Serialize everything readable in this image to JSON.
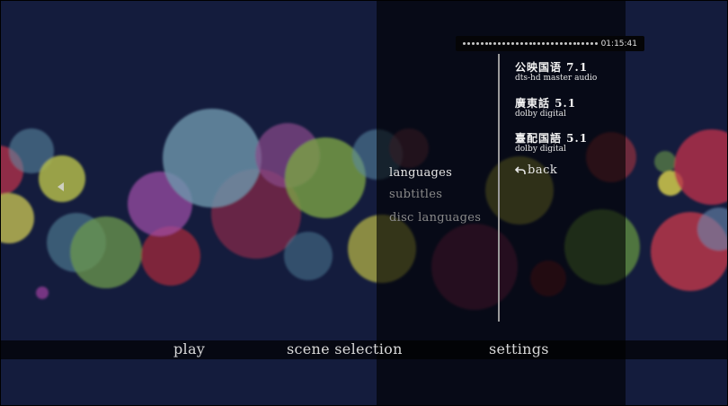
{
  "bottom_nav": {
    "items": [
      {
        "id": "play",
        "label": "play"
      },
      {
        "id": "scene_selection",
        "label": "scene selection"
      },
      {
        "id": "settings",
        "label": "settings"
      }
    ]
  },
  "settings_menu": {
    "items": [
      {
        "id": "languages",
        "label": "languages",
        "state": "active"
      },
      {
        "id": "subtitles",
        "label": "subtitles",
        "state": "dimmed"
      },
      {
        "id": "disc_languages",
        "label": "disc languages",
        "state": "dimmed"
      }
    ]
  },
  "audio_tracks": [
    {
      "title": "公映国语 7.1",
      "subtitle": "dts-hd master audio"
    },
    {
      "title": "廣東話 5.1",
      "subtitle": "dolby digital"
    },
    {
      "title": "臺配国語 5.1",
      "subtitle": "dolby digital"
    }
  ],
  "back": {
    "label": "back",
    "icon": "back-arrow-icon"
  },
  "timeline": {
    "time": "01:15:41"
  },
  "colors": {
    "background": "#141c3d",
    "active_text": "#e6e6e6",
    "dimmed_text": "#8a8a8a",
    "panel_overlay": "#000000"
  }
}
